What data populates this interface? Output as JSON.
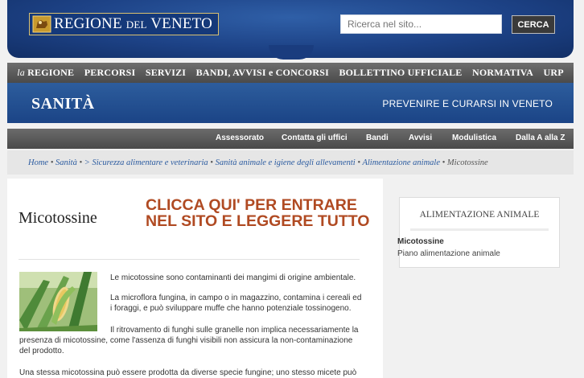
{
  "header": {
    "logo_text_main": "REGIONE",
    "logo_text_small": "DEL",
    "logo_text_end": "VENETO",
    "search_placeholder": "Ricerca nel sito...",
    "search_button_label": "CERCA"
  },
  "main_nav": {
    "items": [
      {
        "prefix": "la",
        "label": "REGIONE"
      },
      {
        "label": "PERCORSI"
      },
      {
        "label": "SERVIZI"
      },
      {
        "label": "BANDI, AVVISI e CONCORSI"
      },
      {
        "label": "BOLLETTINO UFFICIALE"
      },
      {
        "label": "NORMATIVA"
      },
      {
        "label": "URP"
      }
    ]
  },
  "section": {
    "title": "SANITÀ",
    "tagline": "PREVENIRE E CURARSI IN VENETO"
  },
  "sub_nav": {
    "items": [
      "Assessorato",
      "Contatta gli uffici",
      "Bandi",
      "Avvisi",
      "Modulistica",
      "Dalla A alla Z"
    ]
  },
  "breadcrumb": {
    "items": [
      "Home",
      "Sanità",
      "> Sicurezza alimentare e veterinaria",
      "Sanità animale e igiene degli allevamenti",
      "Alimentazione animale"
    ],
    "current": "Micotossine"
  },
  "content": {
    "title": "Micotossine",
    "promo_line1": "CLICCA QUI' PER ENTRARE",
    "promo_line2": "NEL SITO E LEGGERE TUTTO",
    "image_icon": "corn-image",
    "para1": "Le micotossine sono contaminanti dei mangimi di origine ambientale.",
    "para2_line1": "La microflora fungina, in campo o in magazzino, contamina i cereali ed",
    "para2_line2": "i foraggi, e può sviluppare muffe che hanno potenziale tossinogeno.",
    "para3_line1": "Il ritrovamento di funghi sulle granelle non implica necessariamente la",
    "para3_line2": "presenza di micotossine, come l'assenza di funghi visibili non assicura la non-contaminazione",
    "para3_line3": "del prodotto.",
    "para4": "Una stessa micotossina può essere prodotta da diverse specie fungine; uno stesso micete può"
  },
  "sidebar": {
    "title": "ALIMENTAZIONE ANIMALE",
    "links": [
      "Micotossine",
      "Piano alimentazione animale"
    ]
  },
  "colors": {
    "header_blue": "#1d4286",
    "nav_gray": "#4a4a4a",
    "promo_orange": "#b04a22",
    "link_blue": "#2b5ba0"
  }
}
